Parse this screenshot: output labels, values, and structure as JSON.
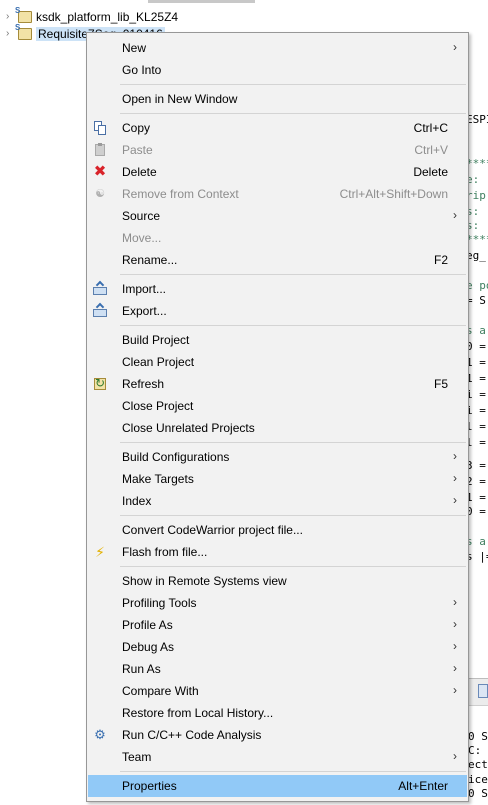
{
  "explorer": {
    "items": [
      {
        "label": "ksdk_platform_lib_KL25Z4",
        "selected": false
      },
      {
        "label": "Requisite7Seg_010416",
        "selected": true
      }
    ]
  },
  "editor": {
    "fragments": [
      "ESPI",
      "****",
      "e:",
      "rip",
      "s:",
      "s:",
      "****",
      "eg_",
      "e po",
      "= S",
      "s a",
      "0 =",
      "1 =",
      "1 =",
      "i =",
      "i =",
      "l =",
      "l =",
      "3 =",
      "2 =",
      "1 =",
      "0 =",
      "s a",
      "s |="
    ]
  },
  "console": {
    "lines": [
      "0 S",
      " C:",
      "ect",
      "ice",
      "0 S"
    ]
  },
  "menu": {
    "items": [
      {
        "label": "New",
        "submenu": true
      },
      {
        "label": "Go Into"
      },
      {
        "label": "Open in New Window"
      },
      {
        "label": "Copy",
        "shortcut": "Ctrl+C",
        "icon": "copy-icon"
      },
      {
        "label": "Paste",
        "shortcut": "Ctrl+V",
        "icon": "paste-icon",
        "disabled": true
      },
      {
        "label": "Delete",
        "shortcut": "Delete",
        "icon": "delete-icon"
      },
      {
        "label": "Remove from Context",
        "shortcut": "Ctrl+Alt+Shift+Down",
        "icon": "remove-context-icon",
        "disabled": true
      },
      {
        "label": "Source",
        "submenu": true
      },
      {
        "label": "Move...",
        "disabled": true
      },
      {
        "label": "Rename...",
        "shortcut": "F2"
      },
      {
        "label": "Import...",
        "icon": "import-icon"
      },
      {
        "label": "Export...",
        "icon": "export-icon"
      },
      {
        "label": "Build Project"
      },
      {
        "label": "Clean Project"
      },
      {
        "label": "Refresh",
        "shortcut": "F5",
        "icon": "refresh-icon"
      },
      {
        "label": "Close Project"
      },
      {
        "label": "Close Unrelated Projects"
      },
      {
        "label": "Build Configurations",
        "submenu": true
      },
      {
        "label": "Make Targets",
        "submenu": true
      },
      {
        "label": "Index",
        "submenu": true
      },
      {
        "label": "Convert CodeWarrior project file..."
      },
      {
        "label": "Flash from file...",
        "icon": "flash-icon"
      },
      {
        "label": "Show in Remote Systems view"
      },
      {
        "label": "Profiling Tools",
        "submenu": true
      },
      {
        "label": "Profile As",
        "submenu": true
      },
      {
        "label": "Debug As",
        "submenu": true
      },
      {
        "label": "Run As",
        "submenu": true
      },
      {
        "label": "Compare With",
        "submenu": true
      },
      {
        "label": "Restore from Local History..."
      },
      {
        "label": "Run C/C++ Code Analysis",
        "icon": "code-analysis-icon"
      },
      {
        "label": "Team",
        "submenu": true
      },
      {
        "label": "Properties",
        "shortcut": "Alt+Enter",
        "highlighted": true
      }
    ]
  },
  "colors": {
    "highlight": "#91c9f7",
    "menu_bg": "#f2f2f2",
    "disabled_text": "#8d8d8d",
    "selection": "#cde3f7"
  }
}
